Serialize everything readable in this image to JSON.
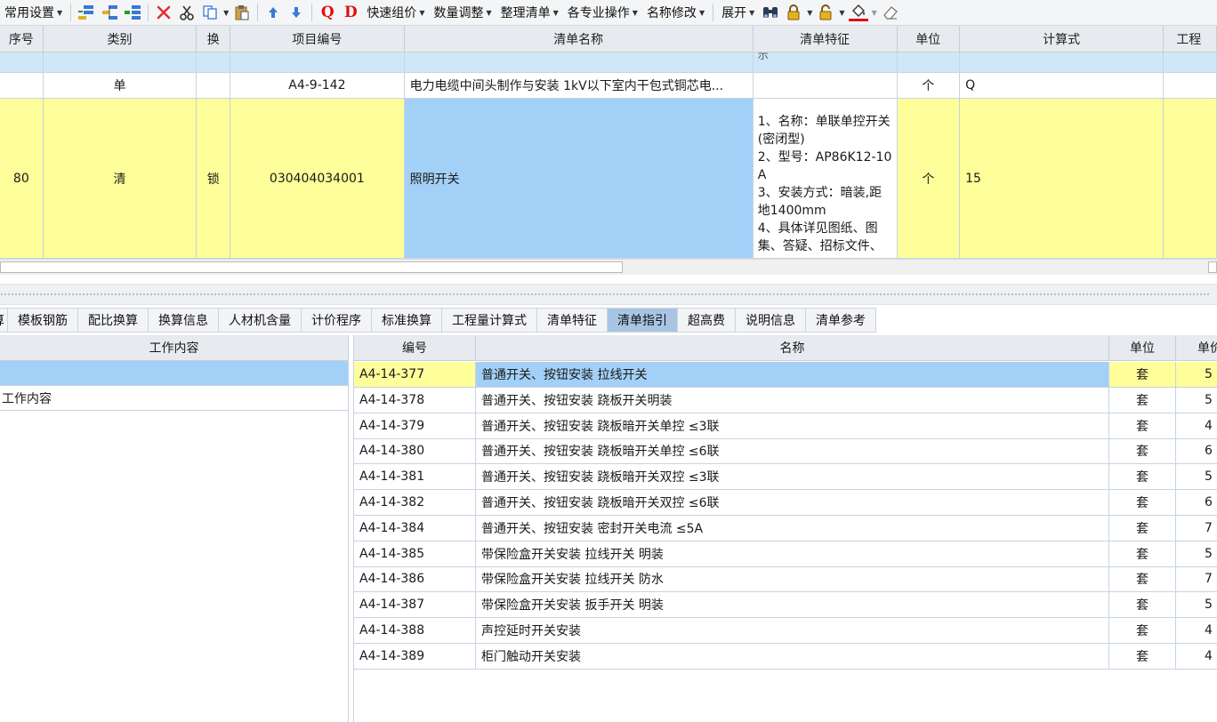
{
  "toolbar": {
    "menu_common": "常用设置",
    "menu_quick_price": "快速组价",
    "menu_qty_adjust": "数量调整",
    "menu_organize": "整理清单",
    "menu_specialty": "各专业操作",
    "menu_rename": "名称修改",
    "menu_expand": "展开",
    "q_glyph": "Q",
    "d_glyph": "D"
  },
  "top_grid": {
    "headers": [
      "序号",
      "类别",
      "换",
      "项目编号",
      "清单名称",
      "清单特征",
      "单位",
      "计算式",
      "工程"
    ],
    "partial_row_text": "示",
    "rows": [
      {
        "seq": "",
        "type": "单",
        "swap": "",
        "code": "A4-9-142",
        "name": "电力电缆中间头制作与安装 1kV以下室内干包式铜芯电...",
        "feature": "",
        "unit": "个",
        "formula": "Q",
        "qty": ""
      },
      {
        "seq": "80",
        "type": "清",
        "swap": "锁",
        "code": "030404034001",
        "name": "照明开关",
        "feature": "1、名称：单联单控开关(密闭型)\n2、型号：AP86K12-10A\n3、安装方式：暗装,距地1400mm\n4、具体详见图纸、图集、答疑、招标文件、",
        "unit": "个",
        "formula": "15",
        "qty": ""
      }
    ]
  },
  "tabs": [
    "模板钢筋",
    "配比换算",
    "换算信息",
    "人材机含量",
    "计价程序",
    "标准换算",
    "工程量计算式",
    "清单特征",
    "清单指引",
    "超高费",
    "说明信息",
    "清单参考"
  ],
  "tab_partial": "算",
  "active_tab": "清单指引",
  "left_panel": {
    "header": "工作内容",
    "items": [
      "",
      "工作内容"
    ]
  },
  "right_grid": {
    "headers": [
      "编号",
      "名称",
      "单位",
      "单价"
    ],
    "rows": [
      {
        "code": "A4-14-377",
        "name": "普通开关、按钮安装 拉线开关",
        "unit": "套",
        "price": "5"
      },
      {
        "code": "A4-14-378",
        "name": "普通开关、按钮安装 跷板开关明装",
        "unit": "套",
        "price": "5"
      },
      {
        "code": "A4-14-379",
        "name": "普通开关、按钮安装 跷板暗开关单控 ≤3联",
        "unit": "套",
        "price": "4"
      },
      {
        "code": "A4-14-380",
        "name": "普通开关、按钮安装 跷板暗开关单控 ≤6联",
        "unit": "套",
        "price": "6"
      },
      {
        "code": "A4-14-381",
        "name": "普通开关、按钮安装 跷板暗开关双控 ≤3联",
        "unit": "套",
        "price": "5"
      },
      {
        "code": "A4-14-382",
        "name": "普通开关、按钮安装 跷板暗开关双控 ≤6联",
        "unit": "套",
        "price": "6"
      },
      {
        "code": "A4-14-384",
        "name": "普通开关、按钮安装 密封开关电流 ≤5A",
        "unit": "套",
        "price": "7"
      },
      {
        "code": "A4-14-385",
        "name": "带保险盒开关安装 拉线开关 明装",
        "unit": "套",
        "price": "5"
      },
      {
        "code": "A4-14-386",
        "name": "带保险盒开关安装 拉线开关 防水",
        "unit": "套",
        "price": "7"
      },
      {
        "code": "A4-14-387",
        "name": "带保险盒开关安装 扳手开关 明装",
        "unit": "套",
        "price": "5"
      },
      {
        "code": "A4-14-388",
        "name": "声控延时开关安装",
        "unit": "套",
        "price": "4"
      },
      {
        "code": "A4-14-389",
        "name": "柜门触动开关安装",
        "unit": "套",
        "price": "4"
      }
    ]
  },
  "colors": {
    "selected_blue": "#a3d0f7",
    "locked_yellow": "#fefe9a",
    "header_gray": "#e7eaee",
    "active_tab": "#a9c5e4",
    "paint_underline": "#e01010"
  }
}
